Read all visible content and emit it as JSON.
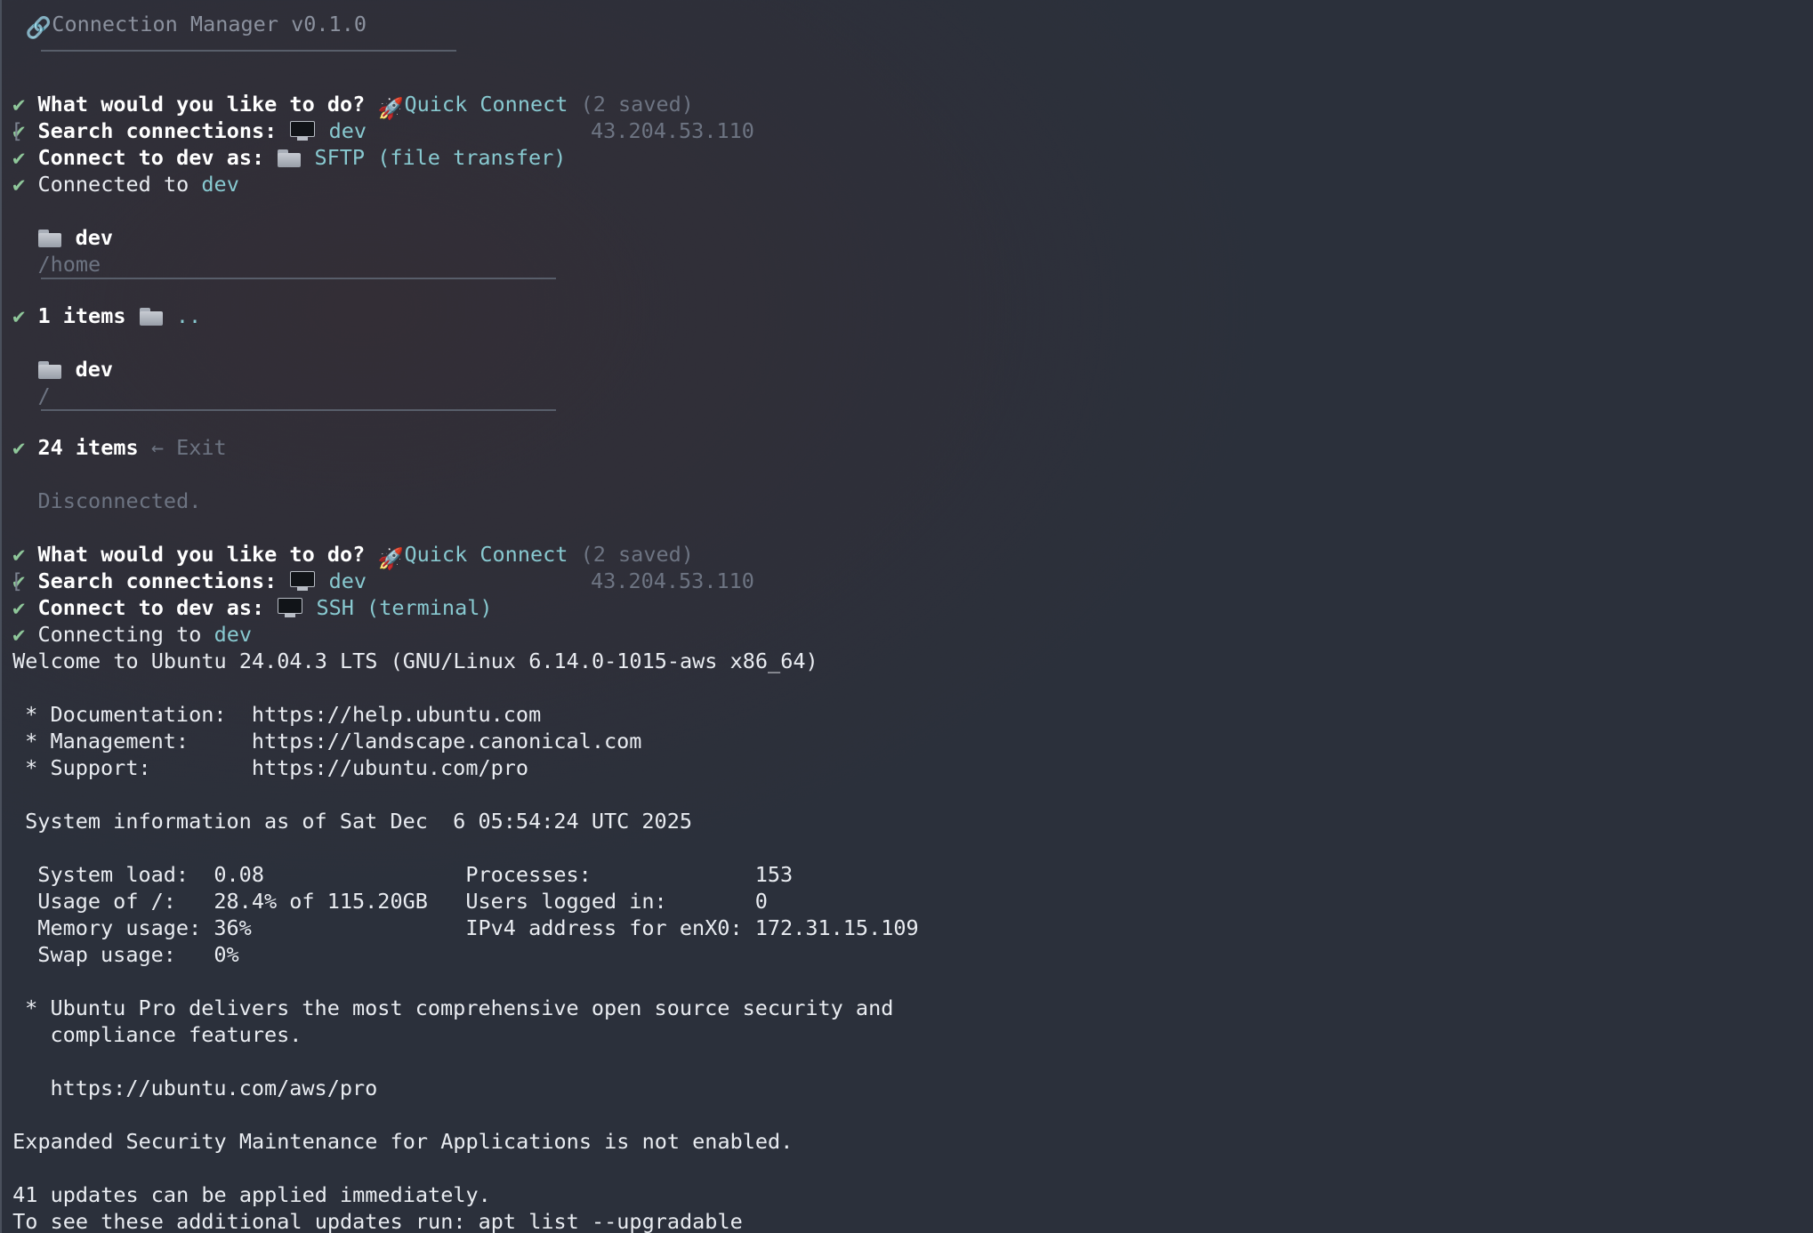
{
  "header": {
    "icon": "link-icon",
    "title": "Connection Manager v0.1.0"
  },
  "check_mark": "✔",
  "session1": {
    "prompt_action": "What would you like to do?",
    "action_choice": "Quick Connect",
    "saved_count": "(2 saved)",
    "search_label": "Search connections:",
    "search_value": "dev",
    "search_ip": "43.204.53.110",
    "connect_as_label": "Connect to dev as:",
    "connect_as_choice": "SFTP (file transfer)",
    "status_prefix": "Connected to",
    "status_host": "dev",
    "browser1": {
      "name": "dev",
      "path": "/home",
      "items_label": "1 items",
      "selected": ".."
    },
    "browser2": {
      "name": "dev",
      "path": "/",
      "items_label": "24 items",
      "selected": "← Exit"
    },
    "disconnected": "Disconnected."
  },
  "session2": {
    "prompt_action": "What would you like to do?",
    "action_choice": "Quick Connect",
    "saved_count": "(2 saved)",
    "search_label": "Search connections:",
    "search_value": "dev",
    "search_ip": "43.204.53.110",
    "connect_as_label": "Connect to dev as:",
    "connect_as_choice": "SSH (terminal)",
    "status_prefix": "Connecting to",
    "status_host": "dev"
  },
  "motd": {
    "welcome": "Welcome to Ubuntu 24.04.3 LTS (GNU/Linux 6.14.0-1015-aws x86_64)",
    "doc": " * Documentation:  https://help.ubuntu.com",
    "mgmt": " * Management:     https://landscape.canonical.com",
    "support": " * Support:        https://ubuntu.com/pro",
    "sysinfo": " System information as of Sat Dec  6 05:54:24 UTC 2025",
    "stat1": "  System load:  0.08                Processes:             153",
    "stat2": "  Usage of /:   28.4% of 115.20GB   Users logged in:       0",
    "stat3": "  Memory usage: 36%                 IPv4 address for enX0: 172.31.15.109",
    "stat4": "  Swap usage:   0%",
    "pro1": " * Ubuntu Pro delivers the most comprehensive open source security and",
    "pro2": "   compliance features.",
    "pro_url": "   https://ubuntu.com/aws/pro",
    "esm": "Expanded Security Maintenance for Applications is not enabled.",
    "updates1": "41 updates can be applied immediately.",
    "updates2": "To see these additional updates run: apt list --upgradable"
  }
}
